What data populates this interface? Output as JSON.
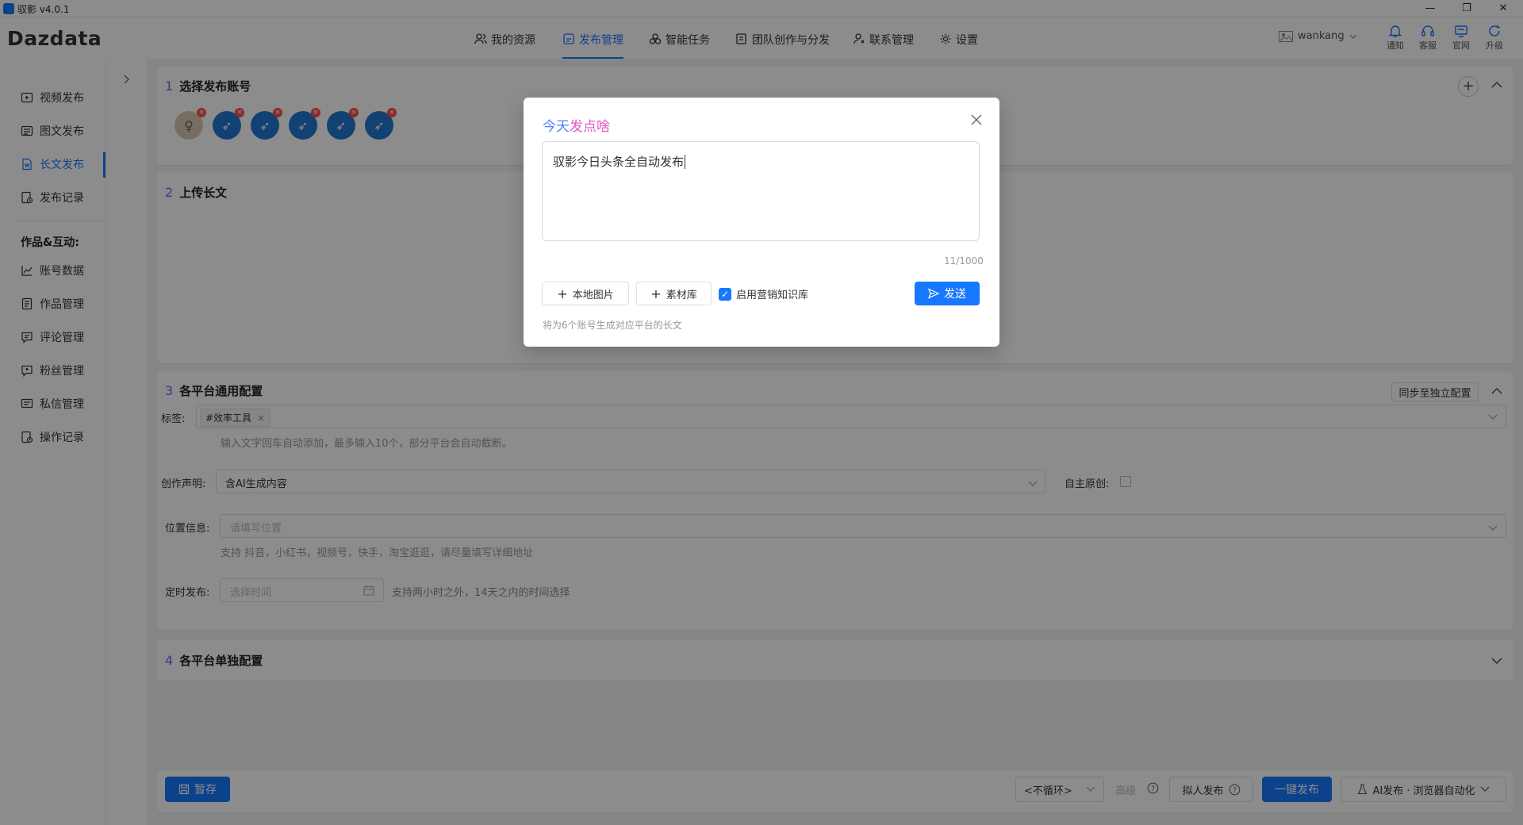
{
  "window": {
    "title": "驭影 v4.0.1",
    "controls": [
      "—",
      "❐",
      "✕"
    ]
  },
  "header": {
    "logo": "Dazdata",
    "nav": [
      {
        "label": "我的资源",
        "icon": "users-icon"
      },
      {
        "label": "发布管理",
        "icon": "publish-icon"
      },
      {
        "label": "智能任务",
        "icon": "cubes-icon"
      },
      {
        "label": "团队创作与分发",
        "icon": "team-share-icon"
      },
      {
        "label": "联系管理",
        "icon": "contact-icon"
      },
      {
        "label": "设置",
        "icon": "gear-icon"
      }
    ],
    "active_nav": "发布管理",
    "username": "wankang",
    "top_icons": [
      {
        "label": "通知",
        "icon": "bell-icon"
      },
      {
        "label": "客服",
        "icon": "headset-icon"
      },
      {
        "label": "官网",
        "icon": "monitor-icon"
      },
      {
        "label": "升级",
        "icon": "refresh-icon"
      }
    ]
  },
  "sidebar": {
    "items": [
      {
        "label": "视频发布",
        "icon": "video-icon"
      },
      {
        "label": "图文发布",
        "icon": "image-text-icon"
      },
      {
        "label": "长文发布",
        "icon": "document-icon"
      },
      {
        "label": "发布记录",
        "icon": "record-icon"
      }
    ],
    "active": "长文发布",
    "section_title": "作品&互动:",
    "section_items": [
      {
        "label": "账号数据",
        "icon": "chart-line-icon"
      },
      {
        "label": "作品管理",
        "icon": "works-icon"
      },
      {
        "label": "评论管理",
        "icon": "comment-icon"
      },
      {
        "label": "粉丝管理",
        "icon": "fans-icon"
      },
      {
        "label": "私信管理",
        "icon": "message-icon"
      },
      {
        "label": "操作记录",
        "icon": "log-icon"
      }
    ]
  },
  "main": {
    "section1": {
      "num": "1",
      "title": "选择发布账号"
    },
    "section2": {
      "num": "2",
      "title": "上传长文"
    },
    "section3": {
      "num": "3",
      "title": "各平台通用配置",
      "sync_button": "同步至独立配置",
      "tags_label": "标签:",
      "tag": "#效率工具",
      "tags_hint": "输入文字回车自动添加，最多输入10个，部分平台会自动截断。",
      "declaration_label": "创作声明:",
      "declaration_value": "含AI生成内容",
      "original_label": "自主原创:",
      "location_label": "位置信息:",
      "location_placeholder": "请填写位置",
      "location_hint": "支持 抖音，小红书，视频号，快手，淘宝逛逛，请尽量填写详细地址",
      "schedule_label": "定时发布:",
      "schedule_placeholder": "选择时间",
      "schedule_hint": "支持两小时之外，14天之内的时间选择"
    },
    "section4": {
      "num": "4",
      "title": "各平台单独配置"
    }
  },
  "footer": {
    "save": "暂存",
    "loop": "<不循环>",
    "advanced": "高级",
    "human_publish": "拟人发布",
    "one_click": "一键发布",
    "ai_publish": "AI发布 · 浏览器自动化"
  },
  "modal": {
    "title_a": "今天",
    "title_b": "发点啥",
    "text": "驭影今日头条全自动发布",
    "count": "11/1000",
    "local_image": "本地图片",
    "material_lib": "素材库",
    "marketing_kb": "启用营销知识库",
    "send": "发送",
    "hint": "将为6个账号生成对应平台的长文"
  }
}
